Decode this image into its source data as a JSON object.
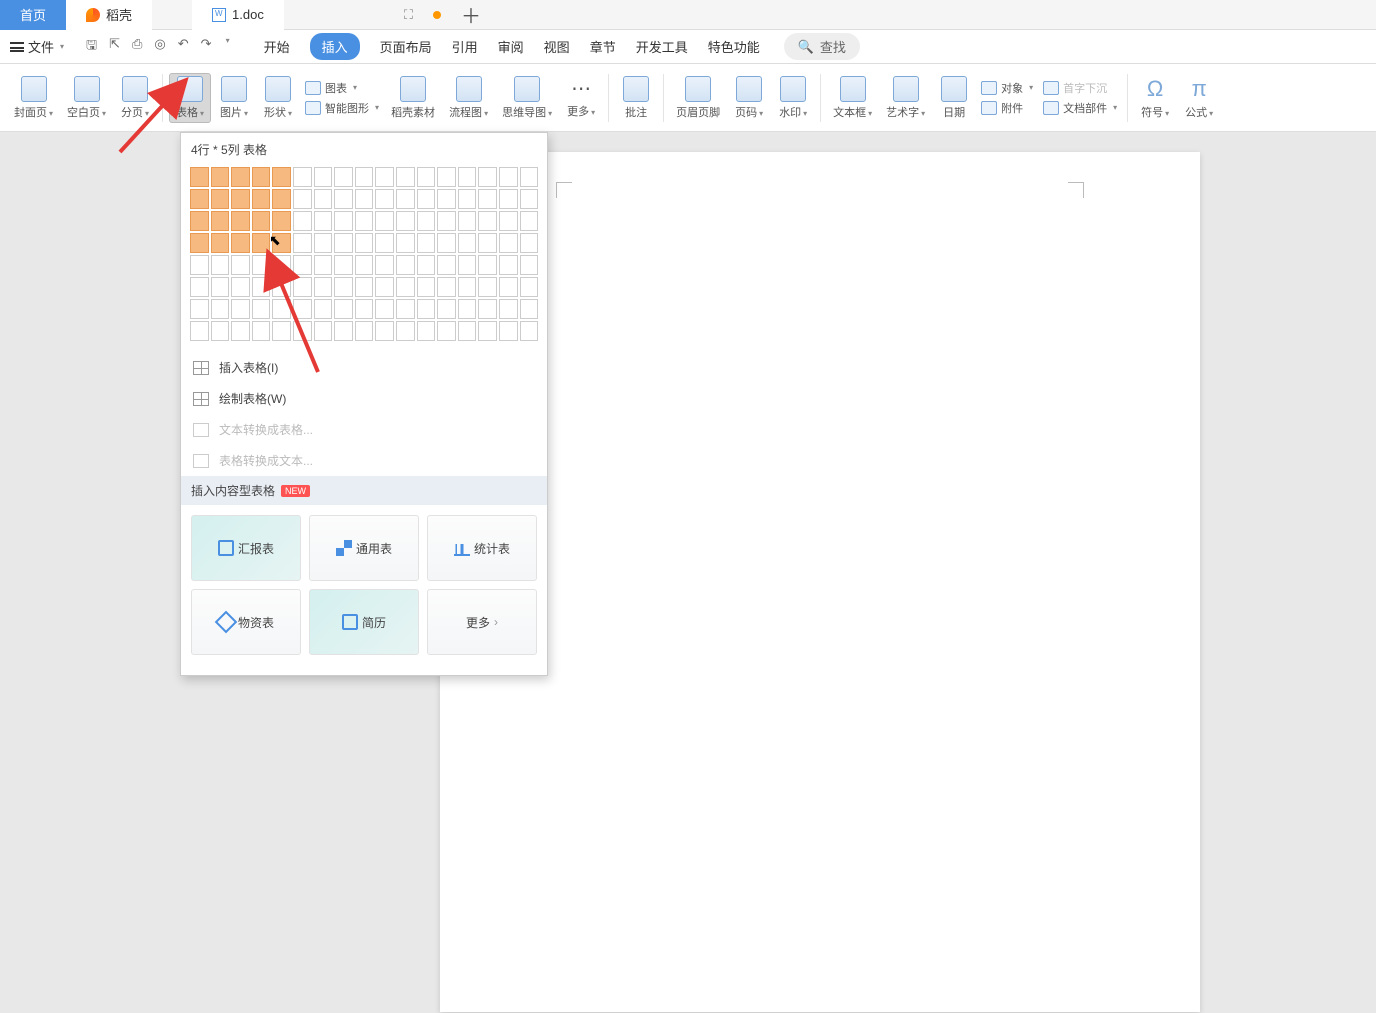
{
  "tabs": {
    "home": "首页",
    "daoke": "稻壳",
    "doc": "1.doc"
  },
  "file_menu": "文件",
  "menu": {
    "start": "开始",
    "insert": "插入",
    "layout": "页面布局",
    "reference": "引用",
    "review": "审阅",
    "view": "视图",
    "section": "章节",
    "dev": "开发工具",
    "special": "特色功能"
  },
  "search": {
    "placeholder": "查找"
  },
  "ribbon": {
    "cover": "封面页",
    "blank": "空白页",
    "break": "分页",
    "table": "表格",
    "image": "图片",
    "shape": "形状",
    "chart": "图表",
    "smart": "智能图形",
    "daoke_res": "稻壳素材",
    "flow": "流程图",
    "mind": "思维导图",
    "more": "更多",
    "comment": "批注",
    "header": "页眉页脚",
    "pagenum": "页码",
    "watermark": "水印",
    "textbox": "文本框",
    "wordart": "艺术字",
    "date": "日期",
    "object": "对象",
    "dropcap": "首字下沉",
    "attach": "附件",
    "docparts": "文档部件",
    "symbol": "符号",
    "equation": "公式"
  },
  "table_dd": {
    "header": "4行 * 5列 表格",
    "rows": 4,
    "cols": 5,
    "grid_rows": 8,
    "grid_cols": 17,
    "insert_table": "插入表格(I)",
    "draw_table": "绘制表格(W)",
    "text_to_table": "文本转换成表格...",
    "table_to_text": "表格转换成文本...",
    "content_tables": "插入内容型表格",
    "badge": "NEW",
    "tpl": {
      "report": "汇报表",
      "general": "通用表",
      "stat": "统计表",
      "supply": "物资表",
      "resume": "简历",
      "more": "更多"
    }
  }
}
